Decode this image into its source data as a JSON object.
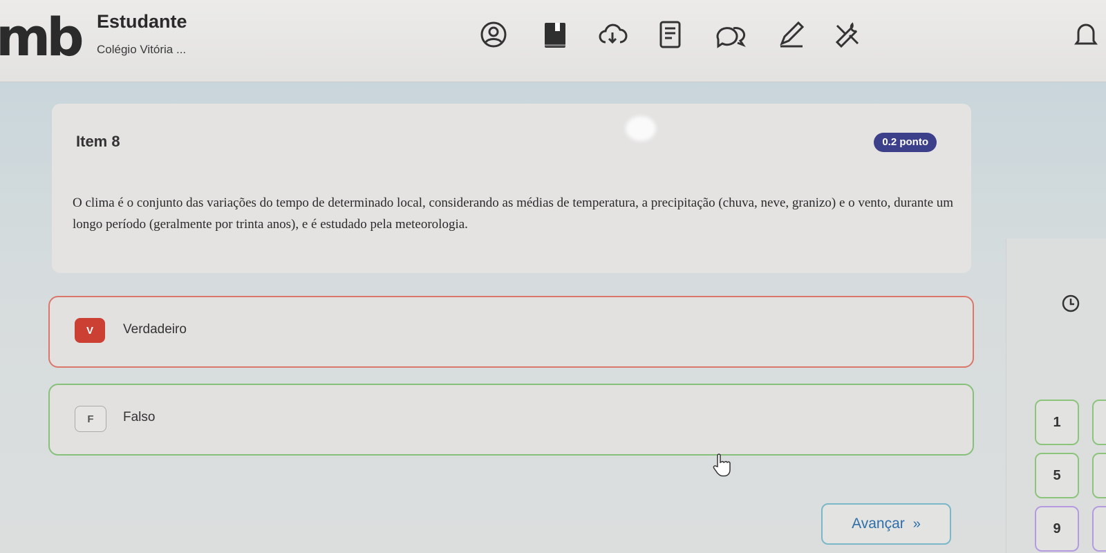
{
  "header": {
    "logo": "mb",
    "student": "Estudante",
    "school": "Colégio Vitória ...",
    "icons": [
      "user-icon",
      "book-icon",
      "cloud-download-icon",
      "notes-icon",
      "chat-icon",
      "pencil-icon",
      "tools-icon",
      "bell-icon"
    ]
  },
  "question": {
    "title": "Item 8",
    "points": "0.2 ponto",
    "text": "O clima é o conjunto das variações do tempo de determinado local, considerando as médias de temperatura, a precipitação (chuva, neve, granizo) e o vento, durante um longo período (geralmente por trinta anos), e é estudado pela meteorologia."
  },
  "options": [
    {
      "letter": "V",
      "label": "Verdadeiro"
    },
    {
      "letter": "F",
      "label": "Falso"
    }
  ],
  "advance": {
    "label": "Avançar",
    "chevron": "»"
  },
  "navigator": {
    "numbers": [
      "1",
      "5",
      "9"
    ]
  },
  "colors": {
    "accent": "#3c3f8a",
    "true": "#cc3f33",
    "false_border": "#86c07a",
    "advance": "#2f6ea8"
  }
}
